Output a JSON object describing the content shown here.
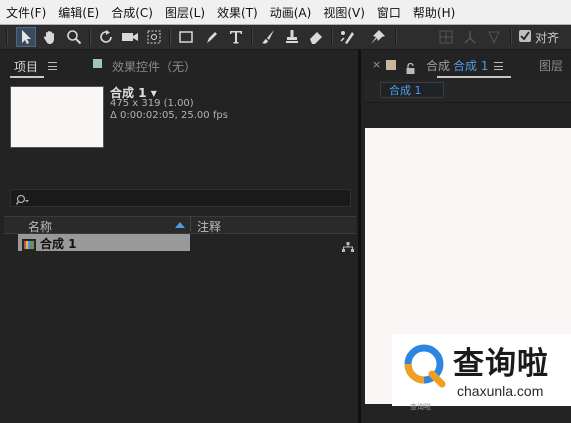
{
  "menu": {
    "items": [
      "文件(F)",
      "编辑(E)",
      "合成(C)",
      "图层(L)",
      "效果(T)",
      "动画(A)",
      "视图(V)",
      "窗口",
      "帮助(H)"
    ]
  },
  "toolbar": {
    "tools": [
      "selection-tool",
      "hand-tool",
      "zoom-tool",
      "rotate-tool",
      "camera-tool",
      "pan-behind-tool",
      "rectangle-tool",
      "pen-tool",
      "type-tool",
      "brush-tool",
      "clone-stamp-tool",
      "eraser-tool",
      "roto-brush-tool",
      "puppet-pin-tool"
    ],
    "align_label": "对齐",
    "align_checked": true
  },
  "project_panel": {
    "tab_project": "项目",
    "tab_effects": "效果控件（无）",
    "comp_name": "合成 1 ▾",
    "comp_dims": "475 x 319 (1.00)",
    "comp_duration": "Δ 0:00:02:05, 25.00 fps",
    "search_placeholder": "",
    "columns": {
      "name": "名称",
      "comment": "注释"
    },
    "items": [
      {
        "label": "合成 1"
      }
    ]
  },
  "comp_panel": {
    "close": "×",
    "tab_label": "合成",
    "tab_comp": "合成 1",
    "layer_tab": "图层",
    "sub_tab": "合成 1"
  },
  "watermark": {
    "title": "查询啦",
    "url": "chaxunla.com",
    "sub": "查询啦"
  },
  "colors": {
    "accent": "#4f9ce6",
    "panel_bg": "#232323",
    "canvas": "#faf6f5"
  }
}
